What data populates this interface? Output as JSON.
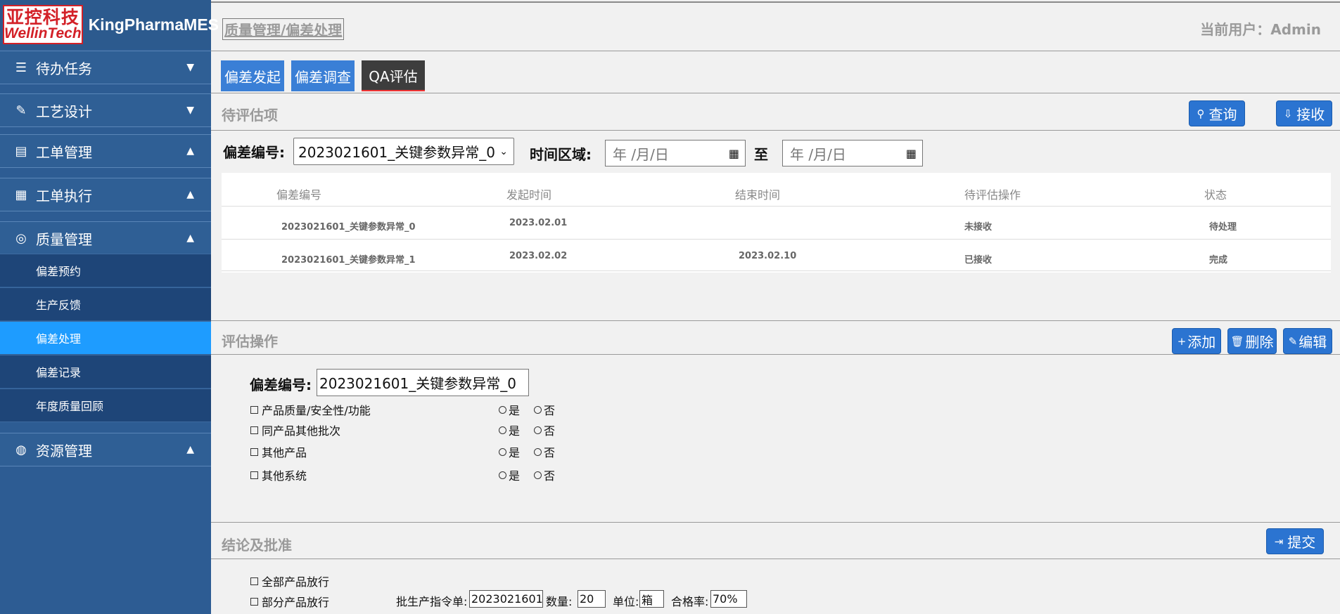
{
  "brand": {
    "logo_cn": "亚控科技",
    "logo_en": "WellinTech",
    "app_name": "KingPharmaMES"
  },
  "sidebar": {
    "menus": [
      {
        "label": "待办任务",
        "icon": "list-icon",
        "arrow": "▼"
      },
      {
        "label": "工艺设计",
        "icon": "tools-icon",
        "arrow": "▼"
      },
      {
        "label": "工单管理",
        "icon": "clipboard-icon",
        "arrow": "▲"
      },
      {
        "label": "工单执行",
        "icon": "document-gear-icon",
        "arrow": "▲"
      },
      {
        "label": "质量管理",
        "icon": "quality-badge-icon",
        "arrow": "▲"
      },
      {
        "label": "资源管理",
        "icon": "globe-icon",
        "arrow": "▲"
      }
    ],
    "submenu": [
      {
        "label": "偏差预约",
        "active": false
      },
      {
        "label": "生产反馈",
        "active": false
      },
      {
        "label": "偏差处理",
        "active": true
      },
      {
        "label": "偏差记录",
        "active": false
      },
      {
        "label": "年度质量回顾",
        "active": false
      }
    ]
  },
  "header": {
    "breadcrumb": "质量管理/偏差处理",
    "user": "当前用户：Admin"
  },
  "tabs": [
    {
      "label": "偏差发起",
      "active": false
    },
    {
      "label": "偏差调查",
      "active": false
    },
    {
      "label": "QA评估",
      "active": true
    }
  ],
  "pending": {
    "title": "待评估项",
    "query_button": "查询",
    "receive_button": "接收",
    "dev_no_label": "偏差编号:",
    "dev_no_value": "2023021601_关键参数异常_0",
    "time_label": "时间区域:",
    "date_placeholder": "年 /月/日",
    "to_label": "至",
    "table": {
      "headers": [
        "偏差编号",
        "发起时间",
        "结束时间",
        "待评估操作",
        "状态"
      ],
      "rows": [
        [
          "2023021601_关键参数异常_0",
          "2023.02.01",
          "",
          "未接收",
          "待处理"
        ],
        [
          "2023021601_关键参数异常_1",
          "2023.02.02",
          "2023.02.10",
          "已接收",
          "完成"
        ]
      ]
    }
  },
  "assessment": {
    "title": "评估操作",
    "add_button": "添加",
    "delete_button": "删除",
    "edit_button": "编辑",
    "dev_no_label": "偏差编号:",
    "dev_no_value": "2023021601_关键参数异常_0",
    "items": [
      "产品质量/安全性/功能",
      "同产品其他批次",
      "其他产品",
      "其他系统"
    ],
    "yes": "是",
    "no": "否"
  },
  "conclusion": {
    "title": "结论及批准",
    "submit_button": "提交",
    "all_release": "全部产品放行",
    "partial_release": "部分产品放行",
    "batch_label": "批生产指令单:",
    "batch_value": "2023021601",
    "qty_label": "数量:",
    "qty_value": "20",
    "unit_label": "单位:",
    "unit_value": "箱",
    "pass_label": "合格率:",
    "pass_value": "70%"
  }
}
